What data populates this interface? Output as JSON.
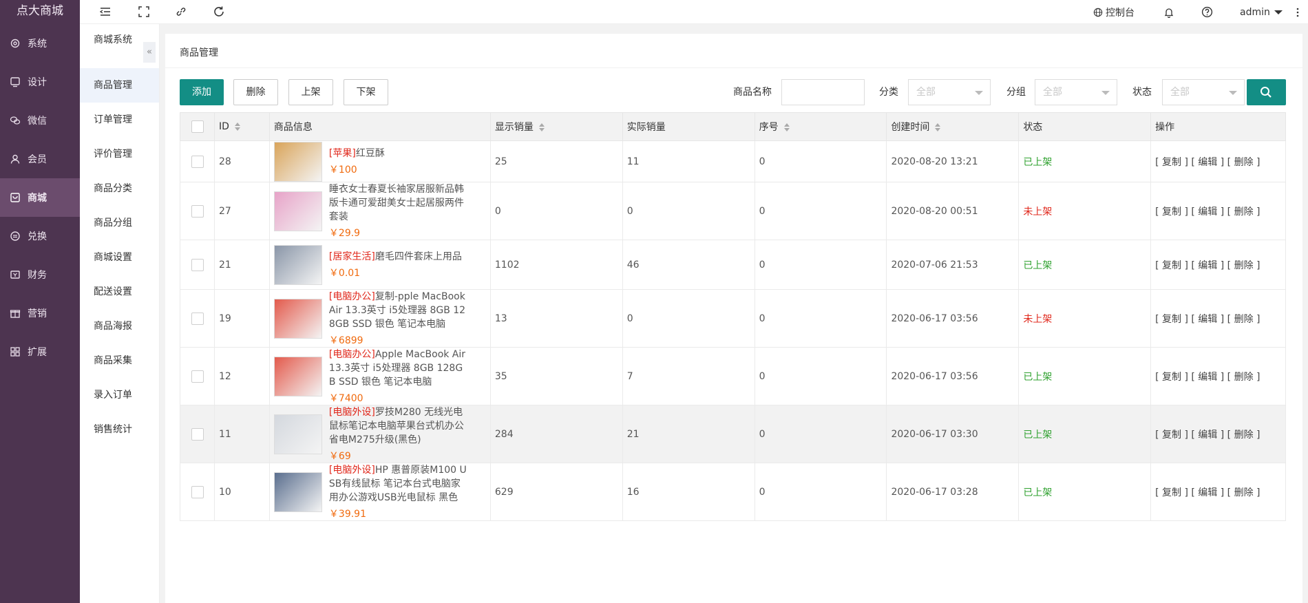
{
  "app": {
    "title": "点大商城"
  },
  "nav": {
    "items": [
      {
        "label": "系统",
        "icon": "gear-icon"
      },
      {
        "label": "设计",
        "icon": "monitor-icon"
      },
      {
        "label": "微信",
        "icon": "wechat-icon"
      },
      {
        "label": "会员",
        "icon": "user-icon"
      },
      {
        "label": "商城",
        "icon": "shop-icon"
      },
      {
        "label": "兑换",
        "icon": "exchange-icon"
      },
      {
        "label": "财务",
        "icon": "wallet-icon"
      },
      {
        "label": "营销",
        "icon": "gift-icon"
      },
      {
        "label": "扩展",
        "icon": "grid-icon"
      }
    ]
  },
  "subnav": {
    "title": "商城系统",
    "collapse": "«",
    "items": [
      "商品管理",
      "订单管理",
      "评价管理",
      "商品分类",
      "商品分组",
      "商城设置",
      "配送设置",
      "商品海报",
      "商品采集",
      "录入订单",
      "销售统计"
    ]
  },
  "topbar": {
    "control": "控制台",
    "user": "admin"
  },
  "breadcrumb": "商品管理",
  "toolbar": {
    "add": "添加",
    "delete": "删除",
    "shelf_on": "上架",
    "shelf_off": "下架"
  },
  "filters": {
    "name_label": "商品名称",
    "category_label": "分类",
    "category_value": "全部",
    "group_label": "分组",
    "group_value": "全部",
    "status_label": "状态",
    "status_value": "全部"
  },
  "table": {
    "headers": [
      "ID",
      "商品信息",
      "显示销量",
      "实际销量",
      "序号",
      "创建时间",
      "状态",
      "操作"
    ],
    "ops": "[ 复制 ] [ 编辑 ] [ 删除 ]",
    "rows": [
      {
        "id": "28",
        "category": "[苹果]",
        "name": "红豆酥",
        "price": "￥100",
        "shown": "25",
        "actual": "11",
        "seq": "0",
        "time": "2020-08-20 13:21",
        "status": "已上架",
        "on": true
      },
      {
        "id": "27",
        "category": "",
        "name": "睡衣女士春夏长袖家居服新品韩版卡通可爱甜美女士起居服两件套装",
        "price": "￥29.9",
        "shown": "0",
        "actual": "0",
        "seq": "0",
        "time": "2020-08-20 00:51",
        "status": "未上架",
        "on": false
      },
      {
        "id": "21",
        "category": "[居家生活]",
        "name": "磨毛四件套床上用品",
        "price": "￥0.01",
        "shown": "1102",
        "actual": "46",
        "seq": "0",
        "time": "2020-07-06 21:53",
        "status": "已上架",
        "on": true
      },
      {
        "id": "19",
        "category": "[电脑办公]",
        "name": "复制-pple MacBook Air 13.3英寸 i5处理器 8GB 128GB SSD 银色 笔记本电脑",
        "price": "￥6899",
        "shown": "13",
        "actual": "0",
        "seq": "0",
        "time": "2020-06-17 03:56",
        "status": "未上架",
        "on": false
      },
      {
        "id": "12",
        "category": "[电脑办公]",
        "name": "Apple MacBook Air 13.3英寸 i5处理器 8GB 128GB SSD 银色 笔记本电脑",
        "price": "￥7400",
        "shown": "35",
        "actual": "7",
        "seq": "0",
        "time": "2020-06-17 03:56",
        "status": "已上架",
        "on": true
      },
      {
        "id": "11",
        "category": "[电脑外设]",
        "name": "罗技M280 无线光电鼠标笔记本电脑苹果台式机办公省电M275升级(黑色)",
        "price": "￥69",
        "shown": "284",
        "actual": "21",
        "seq": "0",
        "time": "2020-06-17 03:30",
        "status": "已上架",
        "on": true
      },
      {
        "id": "10",
        "category": "[电脑外设]",
        "name": "HP 惠普原装M100 USB有线鼠标 笔记本台式电脑家用办公游戏USB光电鼠标 黑色",
        "price": "￥39.91",
        "shown": "629",
        "actual": "16",
        "seq": "0",
        "time": "2020-06-17 03:28",
        "status": "已上架",
        "on": true
      }
    ]
  },
  "colors": {
    "sidebar": "#4d3450",
    "primary": "#138e85",
    "on": "#2fa12f",
    "off": "#e0281c",
    "price": "#f06a0e"
  }
}
